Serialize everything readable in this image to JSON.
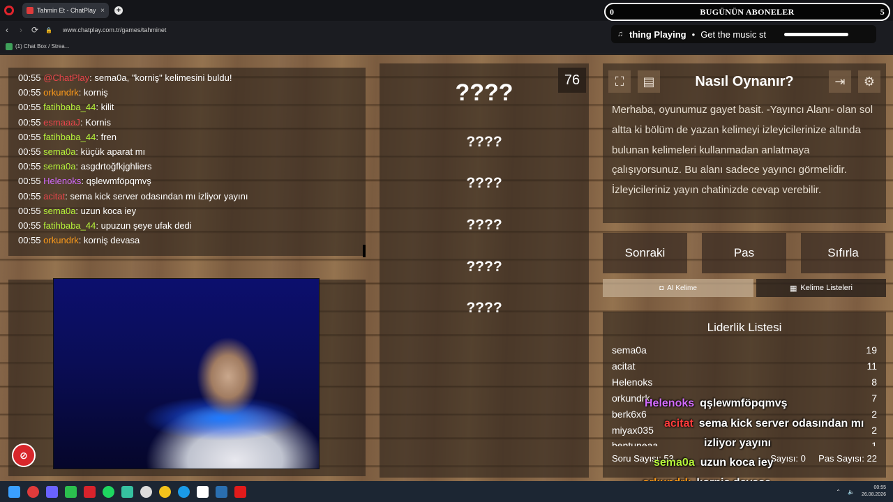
{
  "browser": {
    "tab_title": "Tahmin Et - ChatPlay",
    "url": "www.chatplay.com.tr/games/tahminet",
    "bookmark": "(1) Chat Box / Strea...",
    "new_tab": "+",
    "tab_close": "×",
    "back": "‹",
    "forward": "›",
    "reload": "⟳",
    "lock": "🔒"
  },
  "stream_overlay": {
    "subs_title": "BUGÜNÜN ABONELER",
    "subs_left": "0",
    "subs_right": "5",
    "now_playing": "thing Playing",
    "now_playing_sub": "Get the music st"
  },
  "chat": {
    "lines": [
      {
        "time": "00:55",
        "user": "@ChatPlay",
        "color": "#e8454b",
        "msg": ": sema0a, \"korniş\" kelimesini buldu!"
      },
      {
        "time": "00:55",
        "user": "orkundrk",
        "color": "#ff9c1a",
        "msg": ": korniş"
      },
      {
        "time": "00:55",
        "user": "fatihbaba_44",
        "color": "#b6f53a",
        "msg": ": kilit"
      },
      {
        "time": "00:55",
        "user": "esmaaaJ",
        "color": "#e8454b",
        "msg": ": Kornis"
      },
      {
        "time": "00:55",
        "user": "fatihbaba_44",
        "color": "#b6f53a",
        "msg": ": fren"
      },
      {
        "time": "00:55",
        "user": "sema0a",
        "color": "#b6f53a",
        "msg": ": küçük aparat mı"
      },
      {
        "time": "00:55",
        "user": "sema0a",
        "color": "#b6f53a",
        "msg": ": asgdrtoğfkjghliers"
      },
      {
        "time": "00:55",
        "user": "Helenoks",
        "color": "#d46cff",
        "msg": ": qşlewmföpqmvş"
      },
      {
        "time": "00:55",
        "user": "acitat",
        "color": "#e8454b",
        "msg": ": sema kick server odasından mı izliyor yayını"
      },
      {
        "time": "00:55",
        "user": "sema0a",
        "color": "#b6f53a",
        "msg": ": uzun koca iey"
      },
      {
        "time": "00:55",
        "user": "fatihbaba_44",
        "color": "#b6f53a",
        "msg": ": upuzun şeye ufak dedi"
      },
      {
        "time": "00:55",
        "user": "orkundrk",
        "color": "#ff9c1a",
        "msg": ": korniş devasa"
      }
    ]
  },
  "game": {
    "timer": "76",
    "main_word": "????",
    "words": [
      "????",
      "????",
      "????",
      "????",
      "????"
    ]
  },
  "howto": {
    "title": "Nasıl Oynanır?",
    "text": "Merhaba, oyunumuz gayet basit. -Yayıncı Alanı- olan sol altta ki bölüm de yazan kelimeyi izleyicilerinize altında bulunan kelimeleri kullanmadan anlatmaya çalışıyorsunuz. Bu alanı sadece yayıncı görmelidir. İzleyicileriniz yayın chatinizde cevap verebilir."
  },
  "actions": {
    "next": "Sonraki",
    "pass": "Pas",
    "reset": "Sıfırla",
    "ai_word": "AI Kelime",
    "word_lists": "Kelime Listeleri"
  },
  "leaderboard": {
    "title": "Liderlik Listesi",
    "rows": [
      {
        "name": "sema0a",
        "score": "19"
      },
      {
        "name": "acitat",
        "score": "11"
      },
      {
        "name": "Helenoks",
        "score": "8"
      },
      {
        "name": "orkundrk",
        "score": "7"
      },
      {
        "name": "berk6x6",
        "score": "2"
      },
      {
        "name": "miyax035",
        "score": "2"
      },
      {
        "name": "bentuneaa",
        "score": "1"
      }
    ],
    "question_count": "Soru Sayısı: 53",
    "correct_count": "Sayısı: 0",
    "pass_count": "Pas Sayısı: 22"
  },
  "stream_chat_overlay": [
    {
      "user": "Helenoks",
      "color": "#d46cff",
      "msg": "qşlewmföpqmvş"
    },
    {
      "user": "acitat",
      "color": "#ff3b3b",
      "msg": "sema kick server odasından mı"
    },
    {
      "user": "",
      "color": "#ffffff",
      "msg": "izliyor yayını"
    },
    {
      "user": "sema0a",
      "color": "#b6f53a",
      "msg": "uzun koca iey"
    },
    {
      "user": "orkundrk",
      "color": "#ff9c1a",
      "msg": "korniş devasa"
    }
  ],
  "taskbar": {
    "time": "00:55",
    "date": "26.08.2026"
  }
}
